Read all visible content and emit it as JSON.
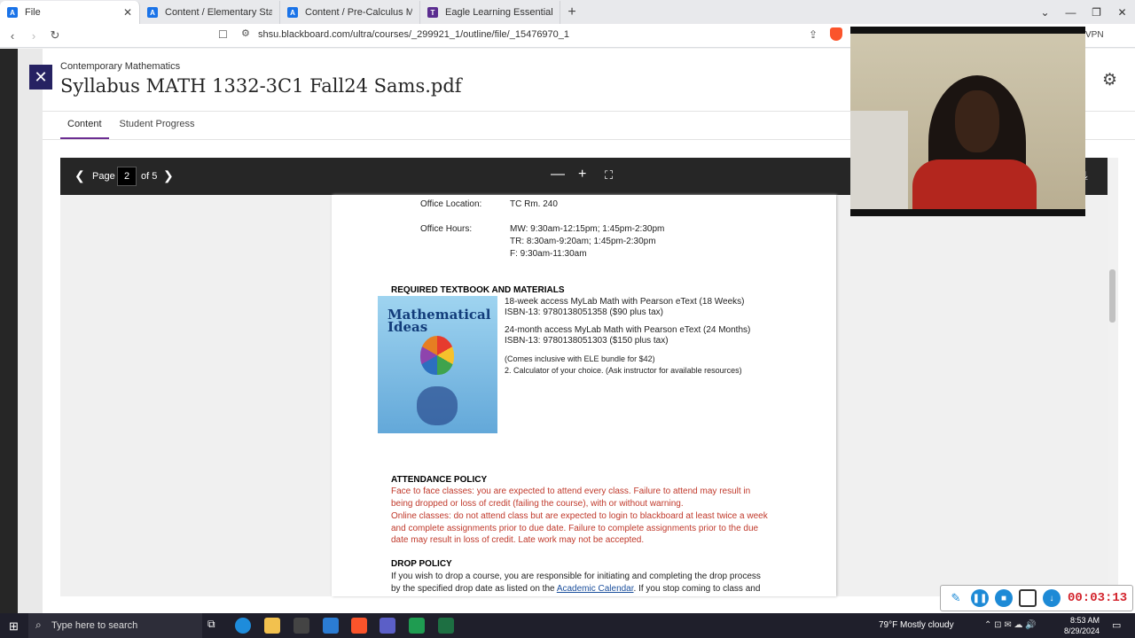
{
  "browser": {
    "tabs": [
      {
        "label": "File",
        "icon": "blackboard-icon",
        "active": true
      },
      {
        "label": "Content / Elementary Statistical Me",
        "icon": "blackboard-icon"
      },
      {
        "label": "Content / Pre-Calculus Math",
        "icon": "blackboard-icon"
      },
      {
        "label": "Eagle Learning Essentials - Lamar In",
        "icon": "purple-app-icon"
      }
    ],
    "new_tab": "+",
    "url": "shsu.blackboard.com/ultra/courses/_299921_1/outline/file/_15476970_1",
    "vpn": "VPN"
  },
  "header": {
    "close": "✕",
    "breadcrumb": "Contemporary Mathematics",
    "title": "Syllabus MATH 1332-3C1 Fall24 Sams.pdf"
  },
  "subtabs": [
    {
      "label": "Content",
      "selected": true
    },
    {
      "label": "Student Progress",
      "selected": false
    }
  ],
  "pdf": {
    "page_label": "Page",
    "current_page": "2",
    "of_label": "of 5",
    "office_location_label": "Office Location:",
    "office_location_value": "TC Rm. 240",
    "office_hours_label": "Office Hours:",
    "office_hours": [
      "MW: 9:30am-12:15pm; 1:45pm-2:30pm",
      "TR: 8:30am-9:20am; 1:45pm-2:30pm",
      "F: 9:30am-11:30am"
    ],
    "textbook_heading": "REQUIRED TEXTBOOK AND MATERIALS",
    "book_cover_title_1": "Mathematical",
    "book_cover_title_2": "Ideas",
    "textbook_lines": [
      "18-week access MyLab Math with Pearson eText (18 Weeks)",
      "ISBN-13: 9780138051358 ($90 plus tax)",
      "24-month access MyLab Math with Pearson eText (24 Months)",
      "ISBN-13: 9780138051303 ($150 plus tax)",
      "(Comes inclusive with ELE bundle for $42)",
      "2.  Calculator of your choice. (Ask instructor for available resources)"
    ],
    "attendance_heading": "ATTENDANCE POLICY",
    "attendance_lines": [
      "Face to face classes: you are expected to attend every class. Failure to attend may result in",
      "being dropped or loss of credit (failing the course), with or without warning.",
      "Online classes: do not attend class but are expected to login to blackboard at least twice a week",
      "and complete assignments prior to due date. Failure to complete assignments prior to the due",
      "date may result in loss of credit. Late work may not be accepted."
    ],
    "drop_heading": "DROP POLICY",
    "drop_line_1": "If you wish to drop a course, you are responsible for initiating and completing the drop process",
    "drop_line_2_pre": "by the specified drop date as listed on the",
    "drop_line_2_link": "Academic Calendar",
    "drop_line_2_post": ".  If you stop coming to class and"
  },
  "recorder": {
    "time": "00:03:13"
  },
  "taskbar": {
    "search_placeholder": "Type here to search",
    "weather": "79°F  Mostly cloudy",
    "time": "8:53 AM",
    "date": "8/29/2024"
  },
  "colors": {
    "accent": "#6b2c91",
    "close_bg": "#262262",
    "policy_red": "#c0392b",
    "recorder_time": "#d3232c"
  }
}
